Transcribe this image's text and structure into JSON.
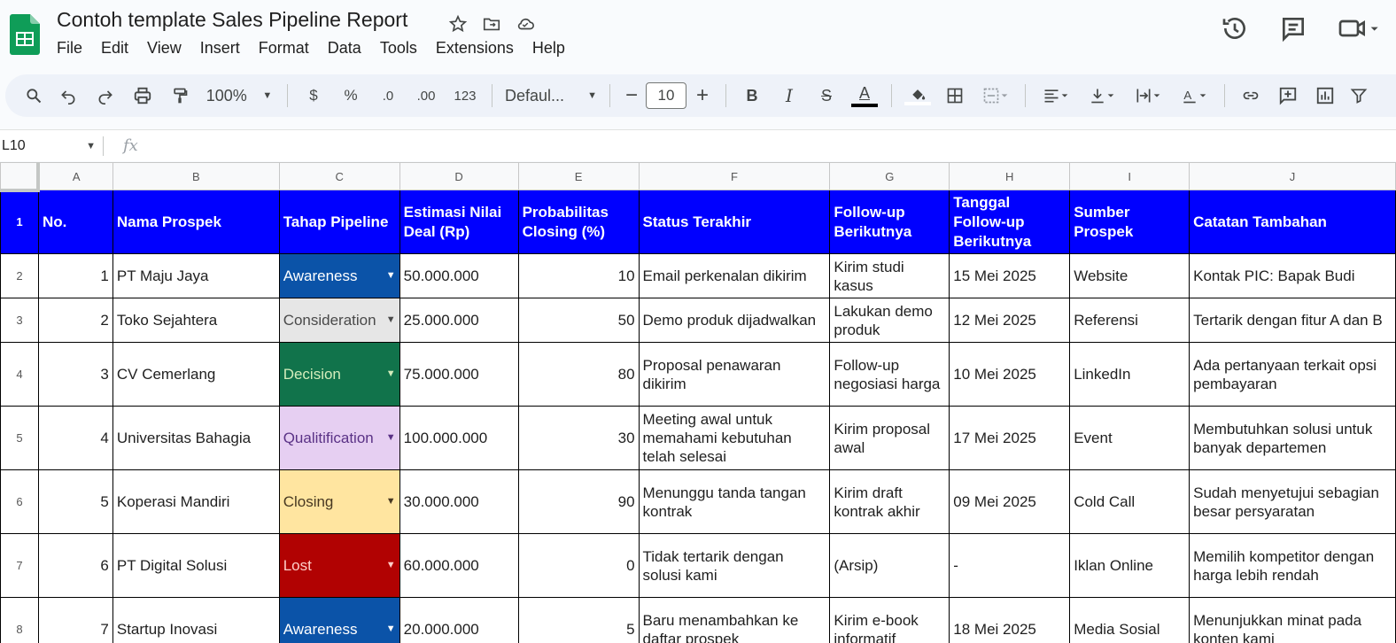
{
  "app": {
    "doc_title": "Contoh template Sales Pipeline Report",
    "menu": [
      "File",
      "Edit",
      "View",
      "Insert",
      "Format",
      "Data",
      "Tools",
      "Extensions",
      "Help"
    ]
  },
  "toolbar": {
    "zoom": "100%",
    "currency": "$",
    "percent": "%",
    "dec_dec": ".0",
    "inc_dec": ".00",
    "format_123": "123",
    "font": "Defaul...",
    "font_size": "10",
    "bold": "B",
    "italic": "I",
    "strike": "S",
    "text_color": "A"
  },
  "formula_bar": {
    "name_box": "L10",
    "fx": "fx"
  },
  "columns": [
    "A",
    "B",
    "C",
    "D",
    "E",
    "F",
    "G",
    "H",
    "I",
    "J"
  ],
  "row_numbers": [
    "1",
    "2",
    "3",
    "4",
    "5",
    "6",
    "7",
    "8"
  ],
  "header": [
    "No.",
    "Nama Prospek",
    "Tahap Pipeline",
    "Estimasi Nilai Deal (Rp)",
    "Probabilitas Closing (%)",
    "Status Terakhir",
    "Follow-up Berikutnya",
    "Tanggal Follow-up Berikutnya",
    "Sumber Prospek",
    "Catatan Tambahan"
  ],
  "rows": [
    {
      "no": "1",
      "nama": "PT Maju Jaya",
      "tahap": "Awareness",
      "estimasi": "50.000.000",
      "prob": "10",
      "status": "Email perkenalan dikirim",
      "follow": "Kirim studi kasus",
      "tanggal": "15 Mei 2025",
      "sumber": "Website",
      "catatan": "Kontak PIC: Bapak Budi"
    },
    {
      "no": "2",
      "nama": "Toko Sejahtera",
      "tahap": "Consideration",
      "estimasi": "25.000.000",
      "prob": "50",
      "status": "Demo produk dijadwalkan",
      "follow": "Lakukan demo produk",
      "tanggal": "12 Mei 2025",
      "sumber": "Referensi",
      "catatan": "Tertarik dengan fitur A dan B"
    },
    {
      "no": "3",
      "nama": "CV Cemerlang",
      "tahap": "Decision",
      "estimasi": "75.000.000",
      "prob": "80",
      "status": "Proposal penawaran dikirim",
      "follow": "Follow-up negosiasi harga",
      "tanggal": "10 Mei 2025",
      "sumber": "LinkedIn",
      "catatan": "Ada pertanyaan terkait opsi pembayaran"
    },
    {
      "no": "4",
      "nama": "Universitas Bahagia",
      "tahap": "Qualitification",
      "estimasi": "100.000.000",
      "prob": "30",
      "status": "Meeting awal untuk memahami kebutuhan telah selesai",
      "follow": "Kirim proposal awal",
      "tanggal": "17 Mei 2025",
      "sumber": "Event",
      "catatan": "Membutuhkan solusi untuk banyak departemen"
    },
    {
      "no": "5",
      "nama": "Koperasi Mandiri",
      "tahap": "Closing",
      "estimasi": "30.000.000",
      "prob": "90",
      "status": "Menunggu tanda tangan kontrak",
      "follow": "Kirim draft kontrak akhir",
      "tanggal": "09 Mei 2025",
      "sumber": "Cold Call",
      "catatan": "Sudah menyetujui sebagian besar persyaratan"
    },
    {
      "no": "6",
      "nama": "PT Digital Solusi",
      "tahap": "Lost",
      "estimasi": "60.000.000",
      "prob": "0",
      "status": "Tidak tertarik dengan solusi kami",
      "follow": "(Arsip)",
      "tanggal": "-",
      "sumber": "Iklan Online",
      "catatan": "Memilih kompetitor dengan harga lebih rendah"
    },
    {
      "no": "7",
      "nama": "Startup Inovasi",
      "tahap": "Awareness",
      "estimasi": "20.000.000",
      "prob": "5",
      "status": "Baru menambahkan ke daftar prospek",
      "follow": "Kirim e-book informatif",
      "tanggal": "18 Mei 2025",
      "sumber": "Media Sosial",
      "catatan": "Menunjukkan minat pada konten kami"
    }
  ],
  "pipeline_colors": {
    "Awareness": {
      "bg": "#0b53a8",
      "fg": "#ffffff"
    },
    "Consideration": {
      "bg": "#e6e6e6",
      "fg": "#4a4a4a"
    },
    "Decision": {
      "bg": "#11734b",
      "fg": "#d4edbc"
    },
    "Qualitification": {
      "bg": "#e6cff2",
      "fg": "#5a3286"
    },
    "Closing": {
      "bg": "#ffe5a0",
      "fg": "#473821"
    },
    "Lost": {
      "bg": "#b10202",
      "fg": "#ffcfc9"
    }
  },
  "header_color": "#0000ff"
}
